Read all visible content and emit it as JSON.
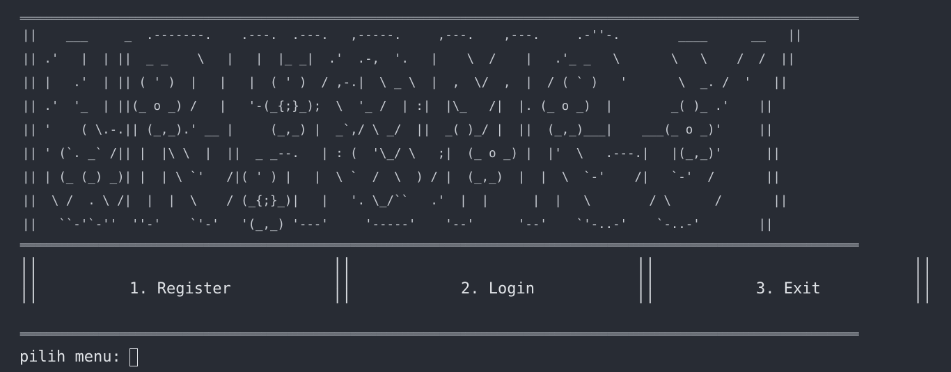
{
  "banner": {
    "separator": "================================================================================================================================================================",
    "art": "||    ___     _  .-------.    .---.  .---.   ,-----.     ,---.    ,---.     .-''-.        ____      __   ||\n|| .'   |  | ||  _ _    \\   |   |  |_ _|  .'  .-,  '.   |    \\  /    |   .'_ _   \\       \\   \\    /  /  ||\n|| |   .'  | || ( ' )  |   |   |  ( ' )  / ,-.|  \\ _ \\  |  ,  \\/  ,  |  / ( ` )   '       \\  _. /  '   ||\n|| .'  '_  | ||(_ o _) /   |   '-(_{;}_);  \\  '_ /  | :|  |\\_   /|  |. (_ o _)  |        _( )_ .'    ||\n|| '    ( \\.-.|| (_,_).' __ |     (_,_) |  _`,/ \\ _/  ||  _( )_/ |  ||  (_,_)___|    ___(_ o _)'     ||\n|| ' (`. _` /|| |  |\\ \\  |  ||  _ _--.   | : (  '\\_/ \\   ;|  (_ o _) |  |'  \\   .---.|   |(_,_)'      ||\n|| | (_ (_) _)| |  | \\ `'   /|( ' ) |   |  \\ `  /  \\  ) / |  (_,_)  |  |  \\  `-'    /|   `-'  /       ||\n||  \\ /  . \\ /|  |  |  \\    / (_{;}_)|   |   '. \\_/``   .'  |  |      |  |   \\        / \\      /       ||\n||   ``-'`-''  ''-'    `'-'   '(_,_) '---'     '-----'    '--'      '--'    `'-..-'    `-..-'        ||"
  },
  "menu": {
    "items": [
      {
        "label": "1. Register"
      },
      {
        "label": "2. Login"
      },
      {
        "label": "3. Exit"
      }
    ]
  },
  "prompt": {
    "text": "pilih menu:"
  },
  "colors": {
    "background": "#282c34",
    "foreground": "#d8dbe0"
  }
}
